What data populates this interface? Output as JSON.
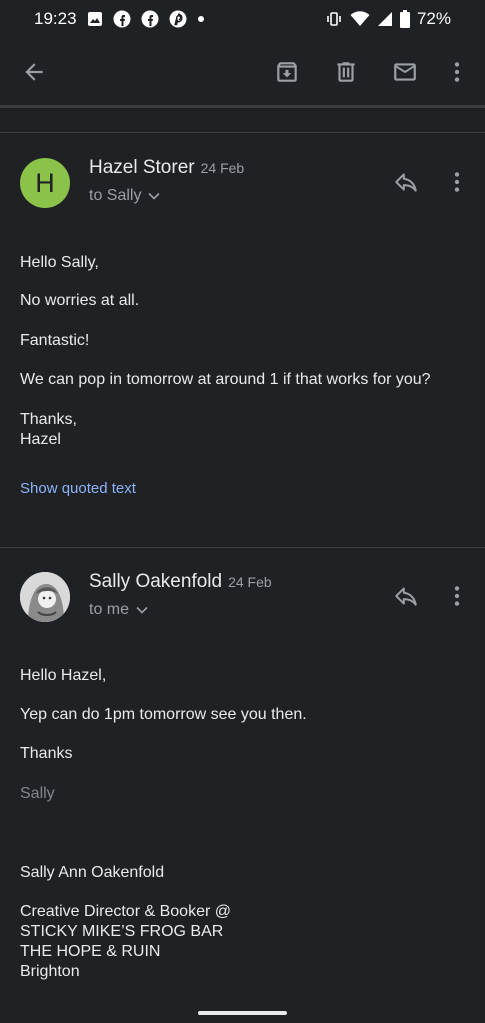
{
  "status_bar": {
    "time": "19:23",
    "battery": "72%"
  },
  "toolbar": {
    "back_icon": "arrow-back-icon",
    "archive_icon": "archive-icon",
    "delete_icon": "trash-icon",
    "mark_unread_icon": "mail-icon",
    "more_icon": "more-vert-icon"
  },
  "messages": [
    {
      "avatar_letter": "H",
      "avatar_color": "#8bc34a",
      "sender": "Hazel Storer",
      "date": "24 Feb",
      "recipient": "to Sally",
      "body": [
        "Hello Sally,",
        "No worries at all.",
        "Fantastic!",
        "We can pop in tomorrow at around 1 if that works for you?",
        "Thanks,",
        "Hazel"
      ],
      "show_quoted": "Show quoted text"
    },
    {
      "sender": "Sally Oakenfold",
      "date": "24 Feb",
      "recipient": "to me",
      "body": [
        "Hello Hazel,",
        "Yep can do 1pm tomorrow see you then.",
        "Thanks",
        "Sally",
        "Sally Ann Oakenfold",
        "Creative Director & Booker @",
        "STICKY MIKE’S FROG BAR",
        "THE HOPE & RUIN",
        "Brighton"
      ]
    }
  ],
  "colors": {
    "background": "#202124",
    "link": "#8ab4f8",
    "text": "#e8eaed",
    "secondary": "#9aa0a6"
  }
}
